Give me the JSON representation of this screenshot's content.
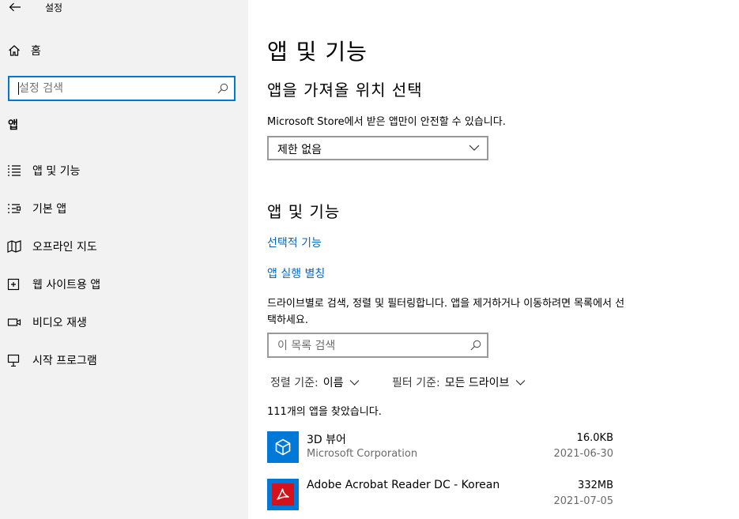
{
  "window": {
    "title": "설정"
  },
  "sidebar": {
    "home_label": "홈",
    "search_placeholder": "설정 검색",
    "section_title": "앱",
    "items": [
      {
        "label": "앱 및 기능",
        "icon": "apps-features-icon"
      },
      {
        "label": "기본 앱",
        "icon": "default-apps-icon"
      },
      {
        "label": "오프라인 지도",
        "icon": "offline-maps-icon"
      },
      {
        "label": "웹 사이트용 앱",
        "icon": "websites-apps-icon"
      },
      {
        "label": "비디오 재생",
        "icon": "video-playback-icon"
      },
      {
        "label": "시작 프로그램",
        "icon": "startup-icon"
      }
    ]
  },
  "main": {
    "page_title": "앱 및 기능",
    "install_source": {
      "heading": "앱을 가져올 위치 선택",
      "description": "Microsoft Store에서 받은 앱만이 안전할 수 있습니다.",
      "dropdown_value": "제한 없음"
    },
    "apps_section": {
      "heading": "앱 및 기능",
      "links": [
        "선택적 기능",
        "앱 실행 별칭"
      ],
      "description": "드라이브별로 검색, 정렬 및 필터링합니다. 앱을 제거하거나 이동하려면 목록에서 선택하세요.",
      "search_placeholder": "이 목록 검색",
      "sort_key": "정렬 기준:",
      "sort_value": "이름",
      "filter_key": "필터 기준:",
      "filter_value": "모든 드라이브",
      "count_text": "111개의 앱을 찾았습니다.",
      "apps": [
        {
          "name": "3D 뷰어",
          "publisher": "Microsoft Corporation",
          "size": "16.0KB",
          "date": "2021-06-30",
          "tile_color": "#0078d7",
          "icon": "3d-viewer-icon"
        },
        {
          "name": "Adobe Acrobat Reader DC - Korean",
          "publisher": "",
          "size": "332MB",
          "date": "2021-07-05",
          "tile_color": "#0078d7",
          "icon": "acrobat-icon"
        }
      ]
    }
  },
  "colors": {
    "accent": "#0078d7",
    "link": "#0067c0",
    "sidebar_bg": "#f2f2f2"
  }
}
